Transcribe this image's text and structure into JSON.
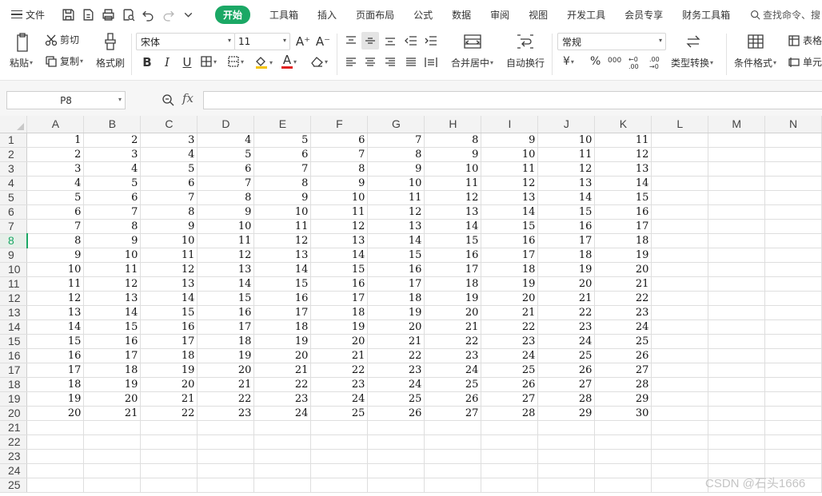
{
  "menubar": {
    "file_label": "文件",
    "tabs": [
      "开始",
      "工具箱",
      "插入",
      "页面布局",
      "公式",
      "数据",
      "审阅",
      "视图",
      "开发工具",
      "会员专享",
      "财务工具箱"
    ],
    "active_tab_index": 0,
    "search_placeholder": "查找命令、搜"
  },
  "ribbon": {
    "paste": "粘贴",
    "cut": "剪切",
    "copy": "复制",
    "format_painter": "格式刷",
    "font_name": "宋体",
    "font_size": "11",
    "grow_font": "A⁺",
    "shrink_font": "A⁻",
    "bold": "B",
    "italic": "I",
    "underline": "U",
    "merge_center": "合并居中",
    "wrap_text": "自动换行",
    "number_format": "常规",
    "currency": "¥",
    "percent": "%",
    "thousands": "000",
    "inc_decimal": "←0 .00",
    "dec_decimal": ".00 →0",
    "type_convert": "类型转换",
    "conditional_format": "条件格式",
    "table_style": "表格",
    "cell": "单元"
  },
  "formula_bar": {
    "name_box": "P8",
    "fx_label": "fx",
    "content": ""
  },
  "sheet": {
    "columns": [
      "A",
      "B",
      "C",
      "D",
      "E",
      "F",
      "G",
      "H",
      "I",
      "J",
      "K",
      "L",
      "M",
      "N"
    ],
    "active_row": 8,
    "rows": [
      [
        1,
        2,
        3,
        4,
        5,
        6,
        7,
        8,
        9,
        10,
        11
      ],
      [
        2,
        3,
        4,
        5,
        6,
        7,
        8,
        9,
        10,
        11,
        12
      ],
      [
        3,
        4,
        5,
        6,
        7,
        8,
        9,
        10,
        11,
        12,
        13
      ],
      [
        4,
        5,
        6,
        7,
        8,
        9,
        10,
        11,
        12,
        13,
        14
      ],
      [
        5,
        6,
        7,
        8,
        9,
        10,
        11,
        12,
        13,
        14,
        15
      ],
      [
        6,
        7,
        8,
        9,
        10,
        11,
        12,
        13,
        14,
        15,
        16
      ],
      [
        7,
        8,
        9,
        10,
        11,
        12,
        13,
        14,
        15,
        16,
        17
      ],
      [
        8,
        9,
        10,
        11,
        12,
        13,
        14,
        15,
        16,
        17,
        18
      ],
      [
        9,
        10,
        11,
        12,
        13,
        14,
        15,
        16,
        17,
        18,
        19
      ],
      [
        10,
        11,
        12,
        13,
        14,
        15,
        16,
        17,
        18,
        19,
        20
      ],
      [
        11,
        12,
        13,
        14,
        15,
        16,
        17,
        18,
        19,
        20,
        21
      ],
      [
        12,
        13,
        14,
        15,
        16,
        17,
        18,
        19,
        20,
        21,
        22
      ],
      [
        13,
        14,
        15,
        16,
        17,
        18,
        19,
        20,
        21,
        22,
        23
      ],
      [
        14,
        15,
        16,
        17,
        18,
        19,
        20,
        21,
        22,
        23,
        24
      ],
      [
        15,
        16,
        17,
        18,
        19,
        20,
        21,
        22,
        23,
        24,
        25
      ],
      [
        16,
        17,
        18,
        19,
        20,
        21,
        22,
        23,
        24,
        25,
        26
      ],
      [
        17,
        18,
        19,
        20,
        21,
        22,
        23,
        24,
        25,
        26,
        27
      ],
      [
        18,
        19,
        20,
        21,
        22,
        23,
        24,
        25,
        26,
        27,
        28
      ],
      [
        19,
        20,
        21,
        22,
        23,
        24,
        25,
        26,
        27,
        28,
        29
      ],
      [
        20,
        21,
        22,
        23,
        24,
        25,
        26,
        27,
        28,
        29,
        30
      ],
      [],
      [],
      [],
      [],
      []
    ]
  },
  "watermark": "CSDN @石头1666",
  "colors": {
    "accent": "#1ba865",
    "grid_line": "#dedede",
    "header_bg": "#f3f3f3"
  }
}
